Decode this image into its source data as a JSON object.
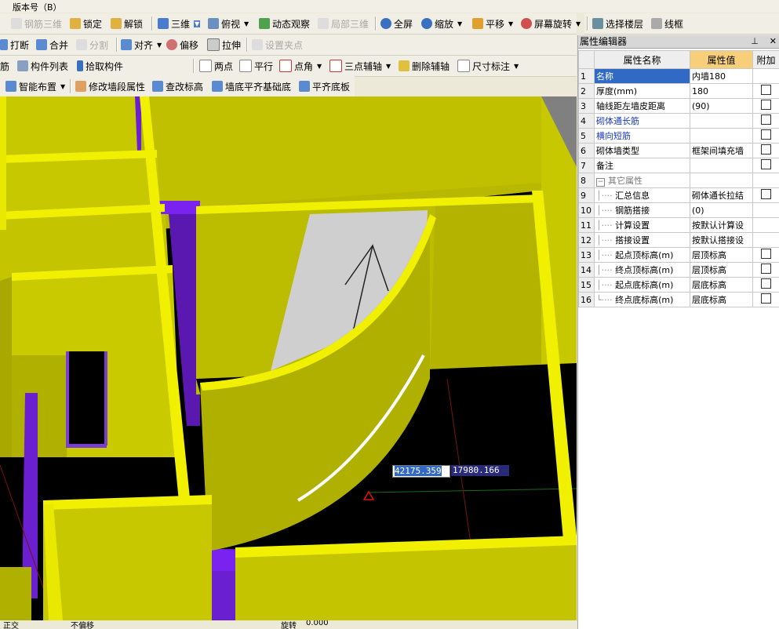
{
  "menubar": {
    "item1": "版本号（B）"
  },
  "toolbar1": {
    "rebar3d": "钢筋三维",
    "lock": "锁定",
    "unlock": "解锁",
    "view3d": "三维",
    "topview": "俯视",
    "dynamic": "动态观察",
    "partial3d": "局部三维",
    "fullscreen": "全屏",
    "zoom": "缩放",
    "pan": "平移",
    "rotate": "屏幕旋转",
    "floor": "选择楼层",
    "wireframe": "线框"
  },
  "toolbar2": {
    "break": "打断",
    "merge": "合并",
    "split": "分割",
    "align": "对齐",
    "offset": "偏移",
    "stretch": "拉伸",
    "gripset": "设置夹点"
  },
  "toolbar3": {
    "rebar": "筋",
    "comp_list": "构件列表",
    "pick": "拾取构件",
    "twopoint": "两点",
    "parallel": "平行",
    "pointangle": "点角",
    "threeaxis": "三点辅轴",
    "delaxis": "删除辅轴",
    "dimension": "尺寸标注"
  },
  "toolbar4": {
    "smart": "智能布置",
    "modify_wall": "修改墙段属性",
    "check_elev": "查改标高",
    "wall_bottom": "墙底平齐基础底",
    "flat_bottom": "平齐底板"
  },
  "coords": {
    "x": "42175.359",
    "y": "17980.166"
  },
  "statusbar": {
    "a": "正交",
    "b": "不偏移",
    "c": "旋转",
    "d": "0.000"
  },
  "panel": {
    "title": "属性编辑器",
    "btn_pin": "⊥",
    "btn_close": "✕",
    "col_name": "属性名称",
    "col_value": "属性值",
    "col_extra": "附加",
    "rows": [
      {
        "n": "1",
        "name": "名称",
        "value": "内墙180"
      },
      {
        "n": "2",
        "name": "厚度(mm)",
        "value": "180"
      },
      {
        "n": "3",
        "name": "轴线距左墙皮距离",
        "value": "(90)"
      },
      {
        "n": "4",
        "name": "砌体通长筋",
        "value": ""
      },
      {
        "n": "5",
        "name": "横向短筋",
        "value": ""
      },
      {
        "n": "6",
        "name": "砌体墙类型",
        "value": "框架间填充墙"
      },
      {
        "n": "7",
        "name": "备注",
        "value": ""
      },
      {
        "n": "8",
        "name": "其它属性",
        "value": "",
        "toggle": "−"
      },
      {
        "n": "9",
        "name": "汇总信息",
        "value": "砌体通长拉结"
      },
      {
        "n": "10",
        "name": "钢筋搭接",
        "value": "(0)"
      },
      {
        "n": "11",
        "name": "计算设置",
        "value": "按默认计算设"
      },
      {
        "n": "12",
        "name": "搭接设置",
        "value": "按默认搭接设"
      },
      {
        "n": "13",
        "name": "起点顶标高(m)",
        "value": "层顶标高"
      },
      {
        "n": "14",
        "name": "终点顶标高(m)",
        "value": "层顶标高"
      },
      {
        "n": "15",
        "name": "起点底标高(m)",
        "value": "层底标高"
      },
      {
        "n": "16",
        "name": "终点底标高(m)",
        "value": "层底标高"
      }
    ]
  },
  "colors": {
    "wall": "#c8c800",
    "wall_edge": "#f0f000",
    "column": "#6a1fd0",
    "selection": "#316ac5",
    "header_value": "#f7cf7a"
  }
}
